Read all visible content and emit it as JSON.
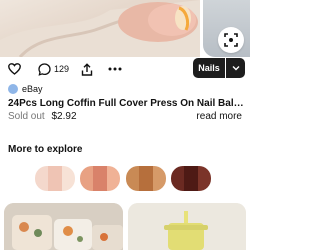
{
  "pin": {
    "like_count": "129",
    "board_button_label": "Nails"
  },
  "source": {
    "name": "eBay"
  },
  "product": {
    "title": "24Pcs Long Coffin Full Cover Press On Nail Ballerina F...",
    "status": "Sold out",
    "price": "$2.92",
    "read_more": "read more"
  },
  "explore": {
    "title": "More to explore",
    "swatches": [
      [
        "#f4d8cc",
        "#efc4b4",
        "#f7e2d6"
      ],
      [
        "#e8a183",
        "#d9826a",
        "#f0b296"
      ],
      [
        "#c98a55",
        "#b66f3c",
        "#d69a68"
      ],
      [
        "#6b2a22",
        "#4e1a15",
        "#7b3429"
      ]
    ]
  },
  "icons": {
    "heart": "heart-icon",
    "comment": "comment-icon",
    "share": "share-icon",
    "more": "more-dots-icon",
    "caret": "chevron-down-icon"
  }
}
